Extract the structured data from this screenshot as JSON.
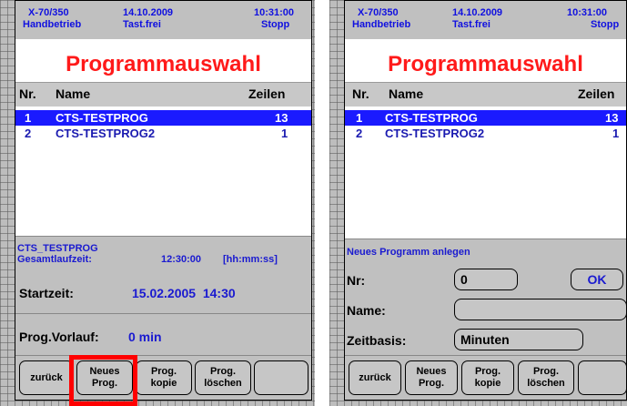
{
  "left": {
    "header": {
      "model": "X-70/350",
      "mode": "Handbetrieb",
      "date": "14.10.2009",
      "keys": "Tast.frei",
      "time": "10:31:00",
      "status": "Stopp"
    },
    "title": "Programmauswahl",
    "columns": {
      "nr": "Nr.",
      "name": "Name",
      "lines": "Zeilen"
    },
    "programs": [
      {
        "nr": "1",
        "name": "CTS-TESTPROG",
        "lines": "13"
      },
      {
        "nr": "2",
        "name": "CTS-TESTPROG2",
        "lines": "1"
      }
    ],
    "info": {
      "program": "CTS_TESTPROG",
      "runtime_label": "Gesamtlaufzeit:",
      "runtime": "12:30:00",
      "unit": "[hh:mm:ss]"
    },
    "start": {
      "label": "Startzeit:",
      "value": "15.02.2005  14:30"
    },
    "prerun": {
      "label": "Prog.Vorlauf:",
      "value": "0 min"
    },
    "softkeys": {
      "back": "zurück",
      "new1": "Neues",
      "new2": "Prog.",
      "copy1": "Prog.",
      "copy2": "kopie",
      "del1": "Prog.",
      "del2": "löschen"
    }
  },
  "right": {
    "header": {
      "model": "X-70/350",
      "mode": "Handbetrieb",
      "date": "14.10.2009",
      "keys": "Tast.frei",
      "time": "10:31:00",
      "status": "Stopp"
    },
    "title": "Programmauswahl",
    "columns": {
      "nr": "Nr.",
      "name": "Name",
      "lines": "Zeilen"
    },
    "programs": [
      {
        "nr": "1",
        "name": "CTS-TESTPROG",
        "lines": "13"
      },
      {
        "nr": "2",
        "name": "CTS-TESTPROG2",
        "lines": "1"
      }
    ],
    "dialog": {
      "heading": "Neues Programm anlegen",
      "nr_label": "Nr:",
      "nr_value": "0",
      "ok": "OK",
      "name_label": "Name:",
      "name_value": "",
      "base_label": "Zeitbasis:",
      "base_value": "Minuten"
    },
    "softkeys": {
      "back": "zurück",
      "new1": "Neues",
      "new2": "Prog.",
      "copy1": "Prog.",
      "copy2": "kopie",
      "del1": "Prog.",
      "del2": "löschen"
    }
  },
  "colors": {
    "accent": "#1a1aff",
    "title": "#ff1a1a",
    "highlight": "#ff0000"
  }
}
